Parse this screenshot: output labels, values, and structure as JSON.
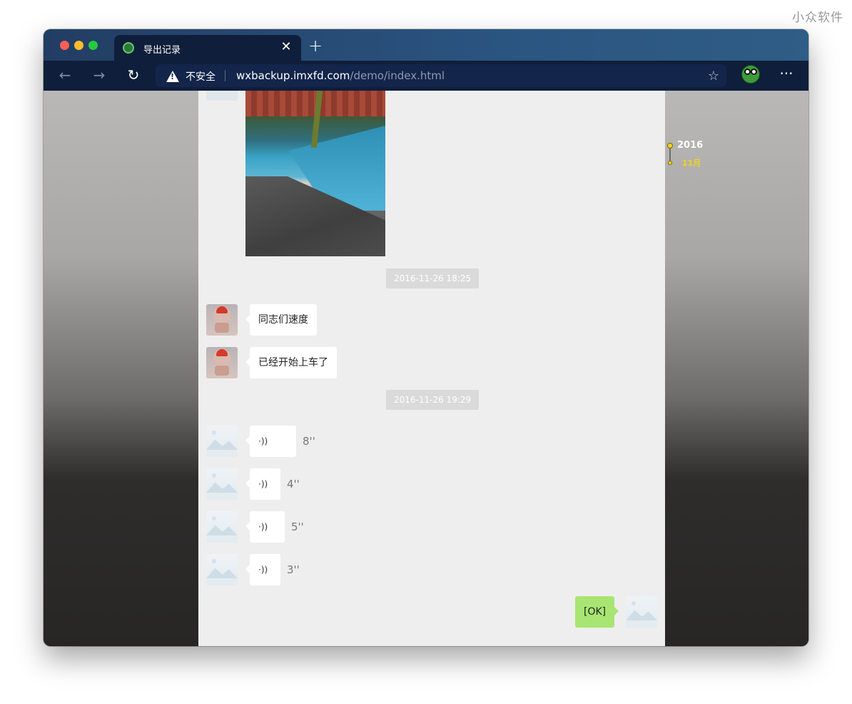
{
  "watermark": "小众软件",
  "browser": {
    "tab_title": "导出记录",
    "tab_close": "✕",
    "new_tab": "+",
    "nav": {
      "back": "←",
      "forward": "→",
      "reload": "↻"
    },
    "security_label": "不安全",
    "url_host": "wxbackup.imxfd.com",
    "url_path": "/demo/index.html",
    "more": "···",
    "favorite_icon": "☆"
  },
  "chat": {
    "timestamps": [
      "2016-11-26 18:25",
      "2016-11-26 19:29"
    ],
    "text_messages": [
      {
        "text": "同志们速度"
      },
      {
        "text": "已经开始上车了"
      }
    ],
    "voice_messages": [
      {
        "icon": "·))",
        "duration": "8''"
      },
      {
        "icon": "·))",
        "duration": "4''"
      },
      {
        "icon": "·))",
        "duration": "5''"
      },
      {
        "icon": "·))",
        "duration": "3''"
      }
    ],
    "sent_message": {
      "text": "[OK]"
    }
  },
  "timeline": {
    "year": "2016",
    "month": "11月"
  }
}
